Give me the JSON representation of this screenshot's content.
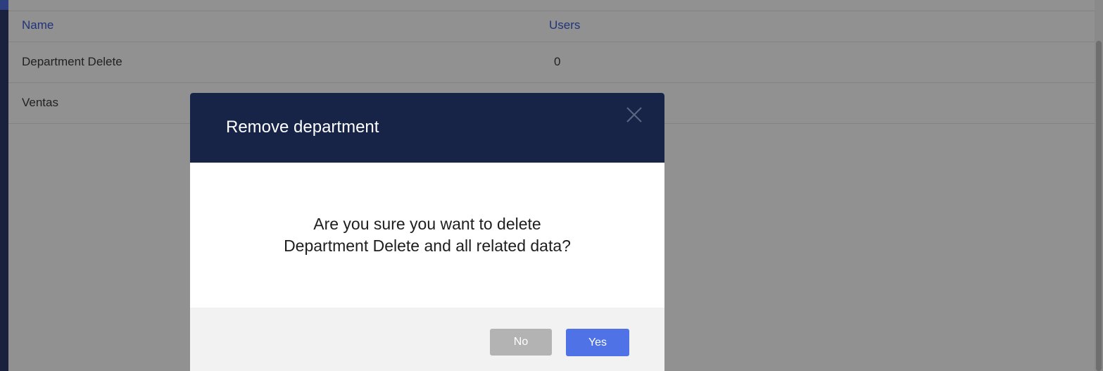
{
  "table": {
    "headers": {
      "name": "Name",
      "users": "Users"
    },
    "rows": [
      {
        "name": "Department Delete",
        "users": "0"
      },
      {
        "name": "Ventas",
        "users": ""
      }
    ]
  },
  "modal": {
    "title": "Remove department",
    "message_line1": "Are you sure you want to delete",
    "message_line2": "Department Delete and all related data?",
    "no_label": "No",
    "yes_label": "Yes",
    "close_icon": "close-icon"
  },
  "colors": {
    "header_bg": "#172448",
    "primary": "#4f72e6",
    "secondary_button": "#b3b3b3",
    "table_header_text": "#3b5bd6"
  }
}
